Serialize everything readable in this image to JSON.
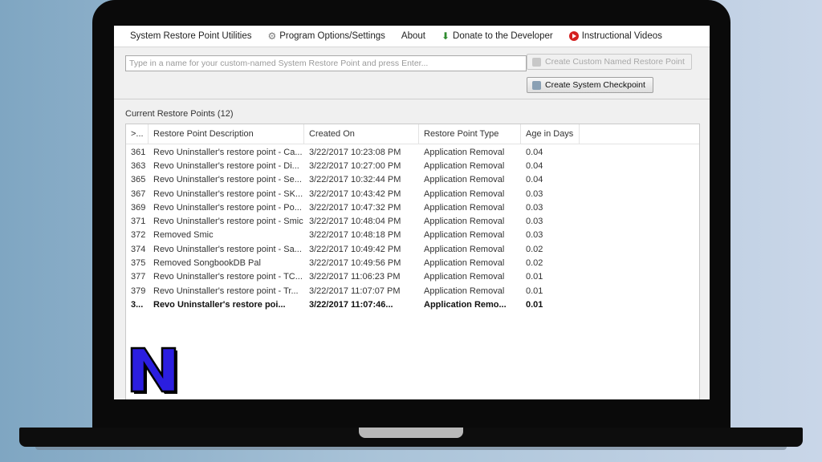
{
  "menubar": {
    "items": [
      {
        "label": "System Restore Point Utilities",
        "icon": ""
      },
      {
        "label": "Program Options/Settings",
        "icon": "gear-icon"
      },
      {
        "label": "About",
        "icon": ""
      },
      {
        "label": "Donate to the Developer",
        "icon": "download-icon"
      },
      {
        "label": "Instructional Videos",
        "icon": "youtube-icon"
      }
    ]
  },
  "toolbar": {
    "name_placeholder": "Type in a name for your custom-named System Restore Point and press Enter...",
    "custom_button_label": "Create Custom Named Restore Point",
    "checkpoint_button_label": "Create System Checkpoint"
  },
  "list": {
    "section_title": "Current Restore Points (12)",
    "columns": [
      ">...",
      "Restore Point Description",
      "Created On",
      "Restore Point Type",
      "Age in Days"
    ],
    "rows": [
      {
        "id": "361",
        "description": "Revo Uninstaller's restore point - Ca...",
        "created": "3/22/2017 10:23:08 PM",
        "type": "Application Removal",
        "age": "0.04",
        "bold": false
      },
      {
        "id": "363",
        "description": "Revo Uninstaller's restore point - Di...",
        "created": "3/22/2017 10:27:00 PM",
        "type": "Application Removal",
        "age": "0.04",
        "bold": false
      },
      {
        "id": "365",
        "description": "Revo Uninstaller's restore point - Se...",
        "created": "3/22/2017 10:32:44 PM",
        "type": "Application Removal",
        "age": "0.04",
        "bold": false
      },
      {
        "id": "367",
        "description": "Revo Uninstaller's restore point - SK...",
        "created": "3/22/2017 10:43:42 PM",
        "type": "Application Removal",
        "age": "0.03",
        "bold": false
      },
      {
        "id": "369",
        "description": "Revo Uninstaller's restore point - Po...",
        "created": "3/22/2017 10:47:32 PM",
        "type": "Application Removal",
        "age": "0.03",
        "bold": false
      },
      {
        "id": "371",
        "description": "Revo Uninstaller's restore point - Smic",
        "created": "3/22/2017 10:48:04 PM",
        "type": "Application Removal",
        "age": "0.03",
        "bold": false
      },
      {
        "id": "372",
        "description": "Removed Smic",
        "created": "3/22/2017 10:48:18 PM",
        "type": "Application Removal",
        "age": "0.03",
        "bold": false
      },
      {
        "id": "374",
        "description": "Revo Uninstaller's restore point - Sa...",
        "created": "3/22/2017 10:49:42 PM",
        "type": "Application Removal",
        "age": "0.02",
        "bold": false
      },
      {
        "id": "375",
        "description": "Removed SongbookDB Pal",
        "created": "3/22/2017 10:49:56 PM",
        "type": "Application Removal",
        "age": "0.02",
        "bold": false
      },
      {
        "id": "377",
        "description": "Revo Uninstaller's restore point - TC...",
        "created": "3/22/2017 11:06:23 PM",
        "type": "Application Removal",
        "age": "0.01",
        "bold": false
      },
      {
        "id": "379",
        "description": "Revo Uninstaller's restore point - Tr...",
        "created": "3/22/2017 11:07:07 PM",
        "type": "Application Removal",
        "age": "0.01",
        "bold": false
      },
      {
        "id": "3...",
        "description": "Revo Uninstaller's restore poi...",
        "created": "3/22/2017 11:07:46...",
        "type": "Application Remo...",
        "age": "0.01",
        "bold": true
      }
    ]
  },
  "logo": {
    "letter": "N",
    "color": "#2b1ee0",
    "outline_color": "#000000"
  }
}
